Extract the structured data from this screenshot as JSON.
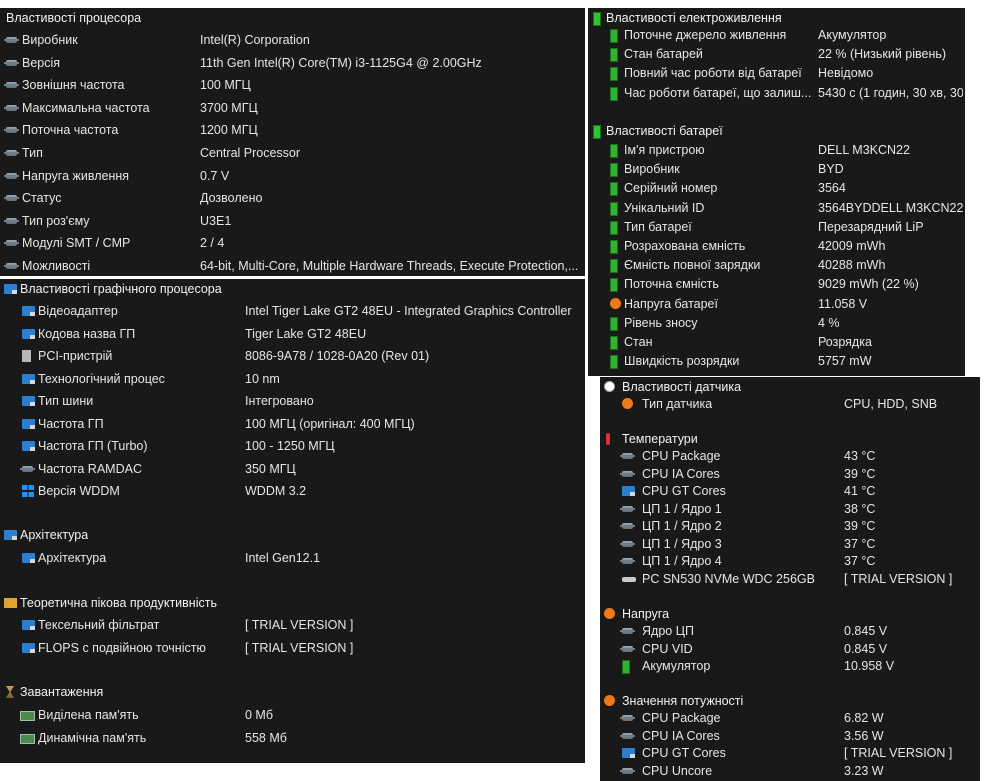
{
  "cpu": {
    "header": "Властивості процесора",
    "rows": [
      {
        "label": "Виробник",
        "value": "Intel(R) Corporation"
      },
      {
        "label": "Версія",
        "value": "11th Gen Intel(R) Core(TM) i3-1125G4 @ 2.00GHz"
      },
      {
        "label": "Зовнішня частота",
        "value": "100 МГЦ"
      },
      {
        "label": "Максимальна частота",
        "value": "3700 МГЦ"
      },
      {
        "label": "Поточна частота",
        "value": "1200 МГЦ"
      },
      {
        "label": "Тип",
        "value": "Central Processor"
      },
      {
        "label": "Напруга живлення",
        "value": "0.7 V"
      },
      {
        "label": "Статус",
        "value": "Дозволено"
      },
      {
        "label": "Тип роз'єму",
        "value": "U3E1"
      },
      {
        "label": "Модулі SMT / CMP",
        "value": "2 / 4"
      },
      {
        "label": "Можливості",
        "value": "64-bit, Multi-Core, Multiple Hardware Threads, Execute Protection,..."
      }
    ]
  },
  "gpu": {
    "header": "Властивості графічного процесора",
    "rows": [
      {
        "label": "Відеоадаптер",
        "value": "Intel Tiger Lake GT2 48EU - Integrated Graphics Controller",
        "icon": "gpu-icon"
      },
      {
        "label": "Кодова назва ГП",
        "value": "Tiger Lake GT2 48EU",
        "icon": "gpu-icon"
      },
      {
        "label": "PCI-пристрій",
        "value": "8086-9A78 / 1028-0A20  (Rev 01)",
        "icon": "pci-icon"
      },
      {
        "label": "Технологічний процес",
        "value": "10 nm",
        "icon": "gpu-icon"
      },
      {
        "label": "Тип шини",
        "value": "Інтегровано",
        "icon": "gpu-icon"
      },
      {
        "label": "Частота ГП",
        "value": "100 МГЦ  (оригінал:  400 МГЦ)",
        "icon": "gpu-icon"
      },
      {
        "label": "Частота ГП (Turbo)",
        "value": "100 - 1250 МГЦ",
        "icon": "gpu-icon"
      },
      {
        "label": "Частота RAMDAC",
        "value": "350 МГЦ",
        "icon": "chip-icon"
      },
      {
        "label": "Версія WDDM",
        "value": "WDDM 3.2",
        "icon": "windows-icon"
      }
    ],
    "arch_header": "Архітектура",
    "arch_rows": [
      {
        "label": "Архітектура",
        "value": "Intel Gen12.1"
      }
    ],
    "perf_header": "Теоретична пікова продуктивність",
    "perf_rows": [
      {
        "label": "Тексельний фільтрат",
        "value": "[ TRIAL VERSION ]"
      },
      {
        "label": "FLOPS с подвійною точністю",
        "value": "[ TRIAL VERSION ]"
      }
    ],
    "load_header": "Завантаження",
    "load_rows": [
      {
        "label": "Виділена пам'ять",
        "value": "0 Мб"
      },
      {
        "label": "Динамічна пам'ять",
        "value": "558 Мб"
      }
    ]
  },
  "power": {
    "header": "Властивості електроживлення",
    "rows": [
      {
        "label": "Поточне джерело живлення",
        "value": "Акумулятор"
      },
      {
        "label": "Стан батарей",
        "value": "22 % (Низький рівень)"
      },
      {
        "label": "Повний час роботи від батареї",
        "value": "Невідомо"
      },
      {
        "label": "Час роботи батареї, що залиш...",
        "value": "5430 с (1 годин, 30 хв, 30"
      }
    ]
  },
  "battery": {
    "header": "Властивості батареї",
    "rows": [
      {
        "label": "Ім'я пристрою",
        "value": "DELL M3KCN22",
        "icon": "battery-icon"
      },
      {
        "label": "Виробник",
        "value": "BYD",
        "icon": "battery-icon"
      },
      {
        "label": "Серійний номер",
        "value": "3564",
        "icon": "battery-icon"
      },
      {
        "label": "Унікальний ID",
        "value": "3564BYDDELL M3KCN22",
        "icon": "battery-icon"
      },
      {
        "label": "Тип батареї",
        "value": "Перезарядний LiP",
        "icon": "battery-icon"
      },
      {
        "label": "Розрахована ємність",
        "value": "42009 mWh",
        "icon": "battery-icon"
      },
      {
        "label": "Ємність повної зарядки",
        "value": "40288 mWh",
        "icon": "battery-icon"
      },
      {
        "label": "Поточна ємність",
        "value": "9029 mWh  (22 %)",
        "icon": "battery-icon"
      },
      {
        "label": "Напруга батареї",
        "value": "11.058 V",
        "icon": "voltage-icon"
      },
      {
        "label": "Рівень зносу",
        "value": "4 %",
        "icon": "battery-icon"
      },
      {
        "label": "Стан",
        "value": "Розрядка",
        "icon": "battery-icon"
      },
      {
        "label": "Швидкість розрядки",
        "value": "5757 mW",
        "icon": "battery-icon"
      }
    ]
  },
  "sensor": {
    "header": "Властивості датчика",
    "type_label": "Тип датчика",
    "type_value": "CPU, HDD, SNB",
    "temp_header": "Температури",
    "temps": [
      {
        "label": "CPU Package",
        "value": "43 °C",
        "icon": "chip-icon"
      },
      {
        "label": "CPU IA Cores",
        "value": "39 °C",
        "icon": "chip-icon"
      },
      {
        "label": "CPU GT Cores",
        "value": "41 °C",
        "icon": "gpu-icon"
      },
      {
        "label": "ЦП 1 / Ядро 1",
        "value": "38 °C",
        "icon": "chip-icon"
      },
      {
        "label": "ЦП 1 / Ядро 2",
        "value": "39 °C",
        "icon": "chip-icon"
      },
      {
        "label": "ЦП 1 / Ядро 3",
        "value": "37 °C",
        "icon": "chip-icon"
      },
      {
        "label": "ЦП 1 / Ядро 4",
        "value": "37 °C",
        "icon": "chip-icon"
      },
      {
        "label": "PC SN530 NVMe WDC 256GB",
        "value": "[ TRIAL VERSION ]",
        "icon": "disk-icon"
      }
    ],
    "volt_header": "Напруга",
    "volts": [
      {
        "label": "Ядро ЦП",
        "value": "0.845 V",
        "icon": "chip-icon"
      },
      {
        "label": "CPU VID",
        "value": "0.845 V",
        "icon": "chip-icon"
      },
      {
        "label": "Акумулятор",
        "value": "10.958 V",
        "icon": "battery-icon"
      }
    ],
    "pow_header": "Значення потужності",
    "pows": [
      {
        "label": "CPU Package",
        "value": "6.82 W",
        "icon": "chip-icon"
      },
      {
        "label": "CPU IA Cores",
        "value": "3.56 W",
        "icon": "chip-icon"
      },
      {
        "label": "CPU GT Cores",
        "value": "[ TRIAL VERSION ]",
        "icon": "gpu-icon"
      },
      {
        "label": "CPU Uncore",
        "value": "3.23 W",
        "icon": "chip-icon"
      }
    ]
  }
}
